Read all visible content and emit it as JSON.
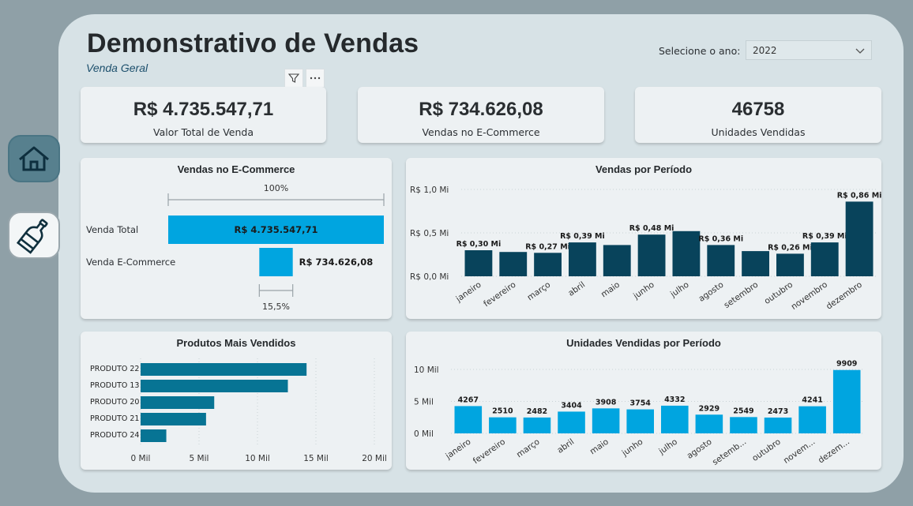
{
  "header": {
    "title": "Demonstrativo de Vendas",
    "subtitle": "Venda Geral",
    "year_label": "Selecione o ano:",
    "year_value": "2022"
  },
  "kpis": [
    {
      "value": "R$ 4.735.547,71",
      "label": "Valor Total de Venda"
    },
    {
      "value": "R$ 734.626,08",
      "label": "Vendas no E-Commerce"
    },
    {
      "value": "46758",
      "label": "Unidades Vendidas"
    }
  ],
  "nav": [
    {
      "icon": "home-icon"
    },
    {
      "icon": "bottle-icon"
    }
  ],
  "colors": {
    "dark_bar": "#08435b",
    "light_bar": "#00a5e0",
    "med_bar": "#077494",
    "background": "#8fa0a7",
    "canvas": "#d7e2e6"
  },
  "chart_data": [
    {
      "type": "bar",
      "title": "Vendas no E-Commerce",
      "categories": [
        "Venda Total",
        "Venda E-Commerce"
      ],
      "values": [
        4735547.71,
        734626.08
      ],
      "data_labels": [
        "R$ 4.735.547,71",
        "R$ 734.626,08"
      ],
      "top_percent_label": "100%",
      "bottom_percent_label": "15,5%"
    },
    {
      "type": "bar",
      "title": "Vendas por Período",
      "categories": [
        "janeiro",
        "fevereiro",
        "março",
        "abril",
        "maio",
        "junho",
        "julho",
        "agosto",
        "setembro",
        "outubro",
        "novembro",
        "dezembro"
      ],
      "values": [
        0.3,
        0.28,
        0.27,
        0.39,
        0.36,
        0.48,
        0.52,
        0.36,
        0.29,
        0.26,
        0.39,
        0.86
      ],
      "data_labels": [
        "R$ 0,30 Mi",
        "",
        "R$ 0,27 Mi",
        "R$ 0,39 Mi",
        "",
        "R$ 0,48 Mi",
        "",
        "R$ 0,36 Mi",
        "",
        "R$ 0,26 Mi",
        "R$ 0,39 Mi",
        "R$ 0,86 Mi"
      ],
      "y_ticks": [
        "R$ 0,0 Mi",
        "R$ 0,5 Mi",
        "R$ 1,0 Mi"
      ],
      "ylim": [
        0,
        1.0
      ]
    },
    {
      "type": "bar",
      "title": "Produtos Mais Vendidos",
      "categories": [
        "PRODUTO 22",
        "PRODUTO 13",
        "PRODUTO 20",
        "PRODUTO 21",
        "PRODUTO 24"
      ],
      "values": [
        14200,
        12600,
        6300,
        5600,
        2200
      ],
      "x_ticks": [
        "0 Mil",
        "5 Mil",
        "10 Mil",
        "15 Mil",
        "20 Mil"
      ],
      "xlim": [
        0,
        20000
      ]
    },
    {
      "type": "bar",
      "title": "Unidades Vendidas por Período",
      "categories": [
        "janeiro",
        "fevereiro",
        "março",
        "abril",
        "maio",
        "junho",
        "julho",
        "agosto",
        "setemb...",
        "outubro",
        "novem...",
        "dezem..."
      ],
      "values": [
        4267,
        2510,
        2482,
        3404,
        3908,
        3754,
        4332,
        2929,
        2549,
        2473,
        4241,
        9909
      ],
      "data_labels": [
        "4267",
        "2510",
        "2482",
        "3404",
        "3908",
        "3754",
        "4332",
        "2929",
        "2549",
        "2473",
        "4241",
        "9909"
      ],
      "y_ticks": [
        "0 Mil",
        "5 Mil",
        "10 Mil"
      ],
      "ylim": [
        0,
        10000
      ]
    }
  ]
}
